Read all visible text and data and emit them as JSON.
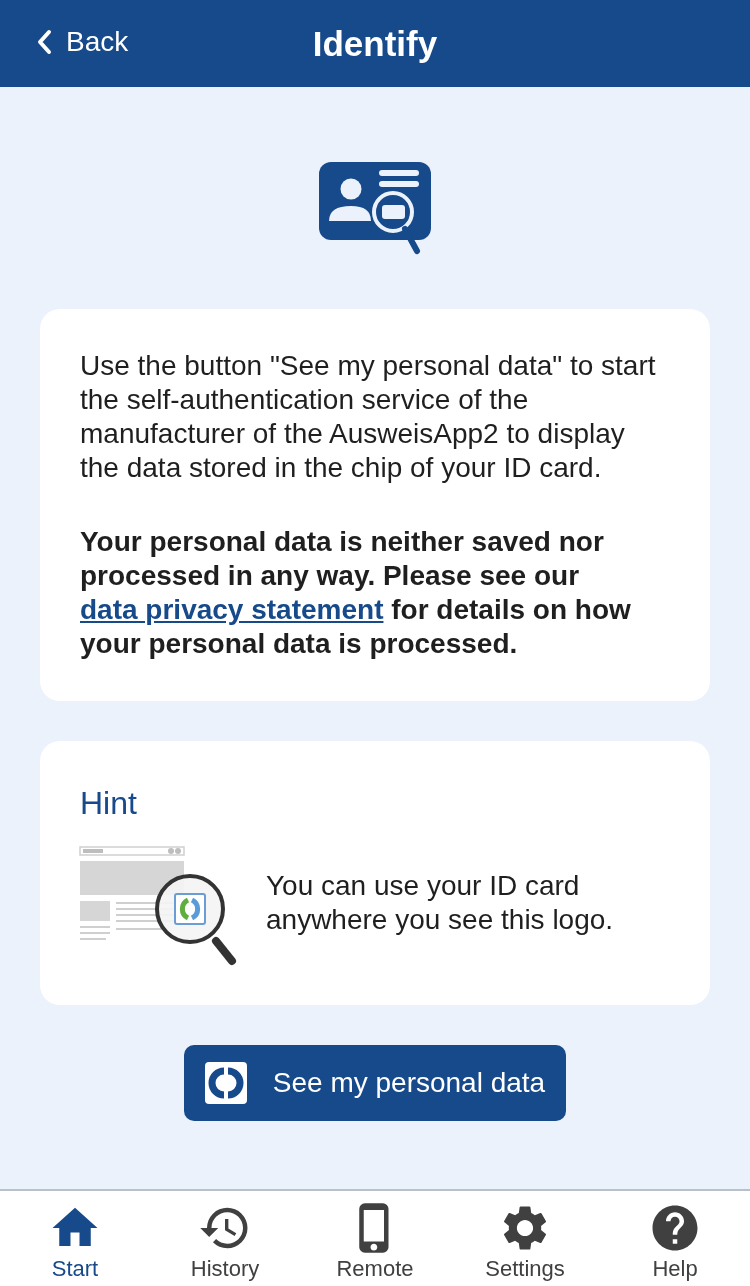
{
  "header": {
    "back_label": "Back",
    "title": "Identify"
  },
  "info_card": {
    "paragraph": "Use the button \"See my personal data\" to start the self-authentication service of the manufacturer of the AusweisApp2 to display the data stored in the chip of your ID card.",
    "notice_before": "Your personal data is neither saved nor processed in any way. Please see our ",
    "notice_link": "data privacy statement",
    "notice_after": " for details on how your personal data is processed."
  },
  "hint_card": {
    "title": "Hint",
    "text": "You can use your ID card anywhere you see this logo."
  },
  "action_button": {
    "label": "See my personal data"
  },
  "nav": [
    {
      "kind": "home",
      "label": "Start",
      "selected": true
    },
    {
      "kind": "history",
      "label": "History",
      "selected": false
    },
    {
      "kind": "phone",
      "label": "Remote",
      "selected": false
    },
    {
      "kind": "settings",
      "label": "Settings",
      "selected": false
    },
    {
      "kind": "help",
      "label": "Help",
      "selected": false
    }
  ]
}
